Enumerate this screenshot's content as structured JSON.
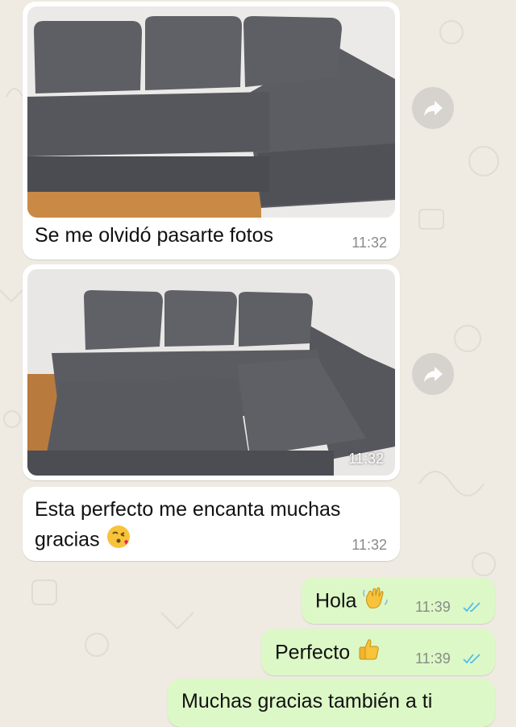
{
  "messages": [
    {
      "id": "m1",
      "type": "photo",
      "caption": "Se me olvidó pasarte fotos",
      "time": "11:32"
    },
    {
      "id": "m2",
      "type": "photo",
      "time": "11:32"
    },
    {
      "id": "m3",
      "type": "text",
      "text_line1": "Esta perfecto me encanta muchas",
      "text_line2": "gracias",
      "emoji": "kissing-face-emoji",
      "time": "11:32"
    },
    {
      "id": "m4",
      "type": "text",
      "text": "Hola",
      "emoji": "waving-hand-emoji",
      "time": "11:39",
      "status": "read"
    },
    {
      "id": "m5",
      "type": "text",
      "text": "Perfecto",
      "emoji": "thumbs-up-emoji",
      "time": "11:39",
      "status": "read"
    },
    {
      "id": "m6",
      "type": "text",
      "text": "Muchas gracias también a ti"
    }
  ],
  "colors": {
    "incoming": "#ffffff",
    "outgoing": "#dcf8c6",
    "read_ticks": "#53bdeb",
    "wallpaper": "#efeae2"
  }
}
